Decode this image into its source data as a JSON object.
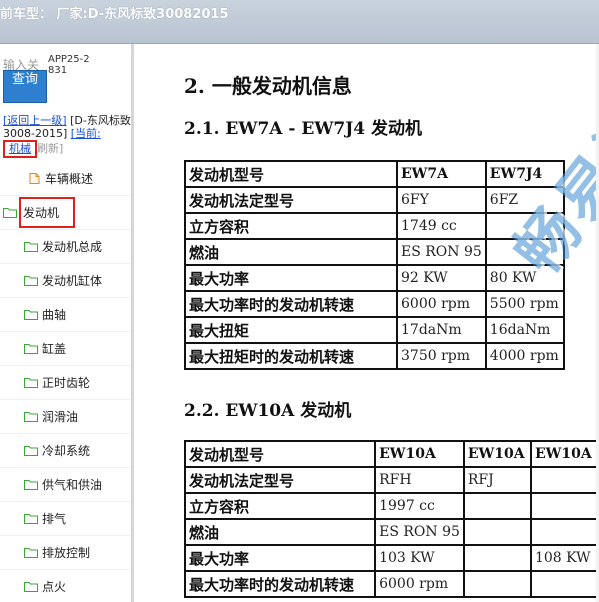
{
  "topbar": {
    "title": "前车型：  厂家:D-东风标致30082015"
  },
  "sidebar": {
    "input_placeholder": "输入关",
    "app_code": "APP25-2831",
    "query_button": "查询",
    "back_link": "[返回上一级]",
    "brand": "[D-东风标致3008-2015]",
    "current_prefix": "[当前:",
    "current_value": "机械",
    "current_suffix": "刷新]",
    "tree": [
      {
        "label": "车辆概述",
        "icon": "page-icon"
      },
      {
        "label": "发动机",
        "icon": "folder-open-icon",
        "selected": true
      },
      {
        "label": "发动机总成",
        "icon": "folder-icon"
      },
      {
        "label": "发动机缸体",
        "icon": "folder-icon"
      },
      {
        "label": "曲轴",
        "icon": "folder-icon"
      },
      {
        "label": "缸盖",
        "icon": "folder-icon"
      },
      {
        "label": "正时齿轮",
        "icon": "folder-icon"
      },
      {
        "label": "润滑油",
        "icon": "folder-icon"
      },
      {
        "label": "冷却系统",
        "icon": "folder-icon"
      },
      {
        "label": "供气和供油",
        "icon": "folder-icon"
      },
      {
        "label": "排气",
        "icon": "folder-icon"
      },
      {
        "label": "排放控制",
        "icon": "folder-icon"
      },
      {
        "label": "点火",
        "icon": "folder-icon"
      }
    ]
  },
  "content": {
    "h1": "2. 一般发动机信息",
    "section1": {
      "title": "2.1. EW7A - EW7J4 发动机",
      "rows": [
        [
          "发动机型号",
          "EW7A",
          "EW7J4"
        ],
        [
          "发动机法定型号",
          "6FY",
          "6FZ"
        ],
        [
          "立方容积",
          "1749 cc",
          ""
        ],
        [
          "燃油",
          "ES RON 95",
          ""
        ],
        [
          "最大功率",
          "92 KW",
          "80 KW"
        ],
        [
          "最大功率时的发动机转速",
          "6000 rpm",
          "5500 rpm"
        ],
        [
          "最大扭矩",
          "17daNm",
          "16daNm"
        ],
        [
          "最大扭矩时的发动机转速",
          "3750 rpm",
          "4000 rpm"
        ]
      ]
    },
    "section2": {
      "title": "2.2. EW10A 发动机",
      "rows": [
        [
          "发动机型号",
          "EW10A",
          "EW10A",
          "EW10A"
        ],
        [
          "发动机法定型号",
          "RFH",
          "RFJ",
          ""
        ],
        [
          "立方容积",
          "1997 cc",
          "",
          ""
        ],
        [
          "燃油",
          "ES RON 95",
          "",
          ""
        ],
        [
          "最大功率",
          "103 KW",
          "",
          "108 KW"
        ],
        [
          "最大功率时的发动机转速",
          "6000 rpm",
          "",
          ""
        ]
      ]
    },
    "watermark": "畅易汽车"
  }
}
